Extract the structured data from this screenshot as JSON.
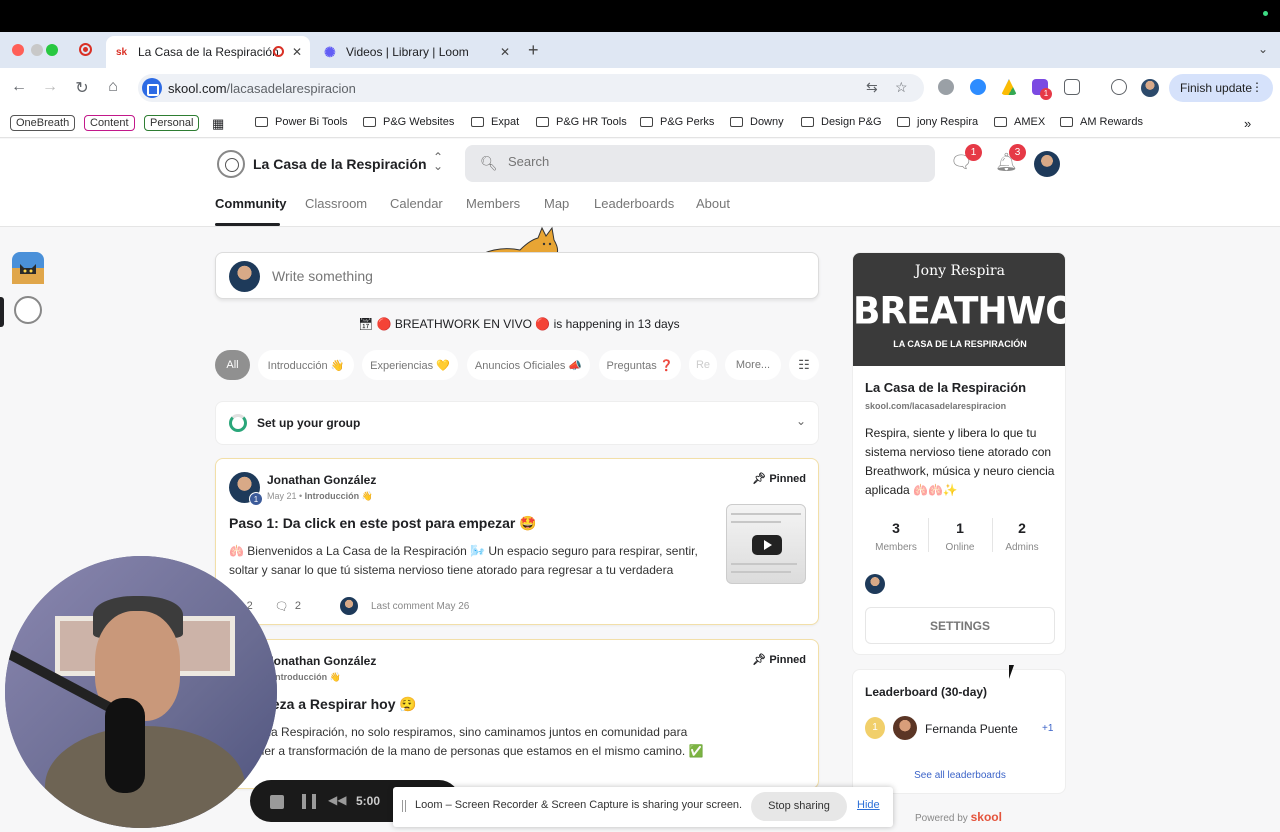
{
  "browser": {
    "tabs": [
      {
        "title": "La Casa de la Respiración",
        "favicon": "sk"
      },
      {
        "title": "Videos | Library | Loom"
      }
    ],
    "url_domain": "skool.com",
    "url_path": "/lacasadelarespiracion",
    "finish_update": "Finish update",
    "ext_badge": "1",
    "bookmark_chips": [
      "OneBreath",
      "Content",
      "Personal"
    ],
    "bookmarks": [
      "Power Bi Tools",
      "P&G Websites",
      "Expat",
      "P&G HR Tools",
      "P&G Perks",
      "Downy",
      "Design P&G",
      "jony Respira",
      "AMEX",
      "AM Rewards"
    ]
  },
  "header": {
    "group_name": "La Casa de la Respiración",
    "search_placeholder": "Search",
    "chat_badge": "1",
    "notif_badge": "3",
    "nav": [
      "Community",
      "Classroom",
      "Calendar",
      "Members",
      "Map",
      "Leaderboards",
      "About"
    ],
    "active_nav": "Community"
  },
  "feed": {
    "write_placeholder": "Write something",
    "event_text": "🔴 BREATHWORK EN VIVO 🔴 is happening in 13 days",
    "filters": [
      "All",
      "Introducción 👋",
      "Experiencias 💛",
      "Anuncios Oficiales 📣",
      "Preguntas ❓",
      "Re",
      "More..."
    ],
    "setup_label": "Set up your group",
    "posts": [
      {
        "author": "Jonathan González",
        "level": "1",
        "date": "May 21",
        "category": "Introducción 👋",
        "pinned": "Pinned",
        "title": "Paso 1: Da click en este post para empezar 🤩",
        "body": "🫁 Bienvenidos a La Casa de la Respiración 🌬️ Un espacio seguro para respirar, sentir, soltar y sanar lo que tú sistema nervioso tiene atorado para regresar a tu verdadera",
        "likes": "2",
        "comments": "2",
        "last_comment": "Last comment May 26"
      },
      {
        "author": "Jonathan González",
        "category": "Introducción 👋",
        "pinned": "Pinned",
        "title": ": Empieza a Respirar hoy 😮‍💨",
        "body": "asa de la Respiración, no solo respiramos, sino caminamos juntos en comunidad para sostener a transformación de la mano de personas que estamos en el mismo camino. ✅ ¡Empieza a"
      }
    ]
  },
  "about_card": {
    "banner_brand": "Jony Respira",
    "banner_big": "BREATHWORK",
    "banner_sub": "LA CASA DE LA RESPIRACIÓN",
    "title": "La Casa de la Respiración",
    "url": "skool.com/lacasadelarespiracion",
    "description": "Respira, siente y libera lo que tu sistema nervioso tiene atorado con Breathwork, música y neuro ciencia aplicada 🫁🫁✨",
    "stats": [
      {
        "n": "3",
        "l": "Members"
      },
      {
        "n": "1",
        "l": "Online"
      },
      {
        "n": "2",
        "l": "Admins"
      }
    ],
    "settings_label": "SETTINGS"
  },
  "leaderboard": {
    "title": "Leaderboard (30-day)",
    "rank": "1",
    "name": "Fernanda Puente",
    "points": "+1",
    "see_all": "See all leaderboards"
  },
  "powered_by": "Powered by",
  "powered_brand": "skool",
  "loom": {
    "timer": "5:00",
    "message": "Loom – Screen Recorder & Screen Capture is sharing your screen.",
    "stop": "Stop sharing",
    "hide": "Hide"
  },
  "colors": {
    "accent_text": "#202124",
    "badge_red": "#e63946",
    "pinned_border": "#f2dfa8",
    "link_blue": "#3c64c8"
  }
}
